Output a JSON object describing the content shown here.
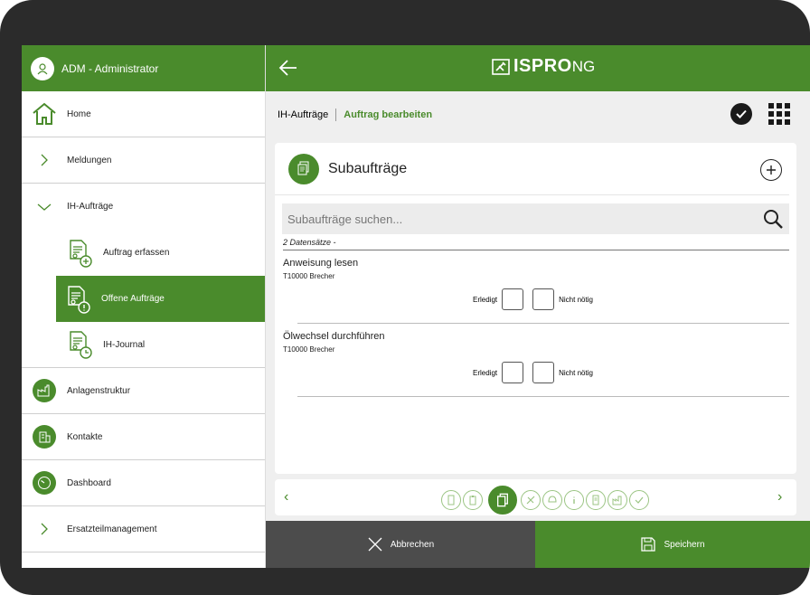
{
  "app": {
    "logo_main": "ISPRO",
    "logo_suffix": "NG",
    "accent": "#4a8b2c"
  },
  "sidebar": {
    "user": "ADM - Administrator",
    "items": [
      {
        "label": "Home",
        "icon": "house-icon"
      },
      {
        "label": "Meldungen",
        "icon": "chevron-right-icon"
      },
      {
        "label": "IH-Aufträge",
        "icon": "chevron-down-icon"
      },
      {
        "label": "Auftrag erfassen",
        "icon": "document-add-icon"
      },
      {
        "label": "Offene Aufträge",
        "icon": "document-alert-icon"
      },
      {
        "label": "IH-Journal",
        "icon": "document-clock-icon"
      },
      {
        "label": "Anlagenstruktur",
        "icon": "factory-icon"
      },
      {
        "label": "Kontakte",
        "icon": "building-icon"
      },
      {
        "label": "Dashboard",
        "icon": "gauge-icon"
      },
      {
        "label": "Ersatzteilmanagement",
        "icon": "chevron-right-icon"
      }
    ]
  },
  "breadcrumb": {
    "parent": "IH-Aufträge",
    "current": "Auftrag bearbeiten"
  },
  "card": {
    "title": "Subaufträge",
    "search_placeholder": "Subaufträge suchen...",
    "count": "2 Datensätze  -",
    "tasks": [
      {
        "title": "Anweisung lesen",
        "sub": "T10000 Brecher",
        "done_label": "Erledigt",
        "notneeded_label": "Nicht nötig"
      },
      {
        "title": "Ölwechsel durchführen",
        "sub": "T10000 Brecher",
        "done_label": "Erledigt",
        "notneeded_label": "Nicht nötig"
      }
    ]
  },
  "pager": {
    "prev": "‹",
    "next": "›"
  },
  "actions": {
    "cancel": "Abbrechen",
    "save": "Speichern"
  }
}
